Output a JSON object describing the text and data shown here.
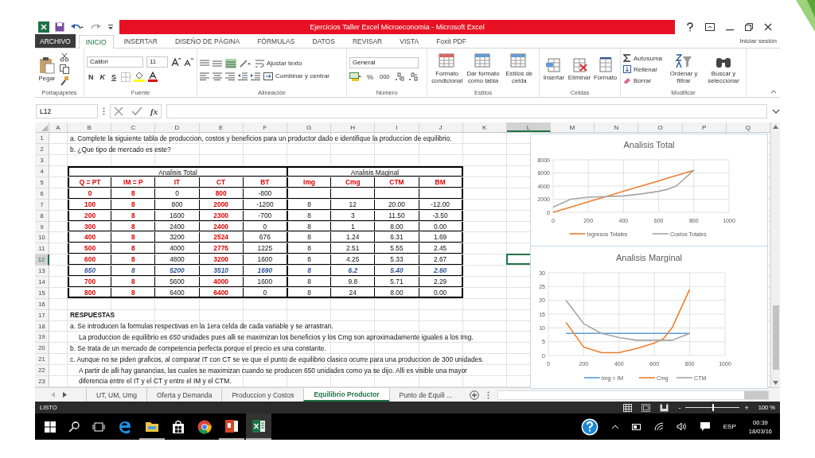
{
  "window": {
    "title": "Ejercicios Taller Excel Microeconomia -  Microsoft Excel"
  },
  "ribbon_tabs": [
    {
      "label": "ARCHIVO",
      "kind": "file",
      "selected": false
    },
    {
      "label": "INICIO",
      "kind": "tab",
      "selected": true
    },
    {
      "label": "INSERTAR",
      "kind": "tab",
      "selected": false
    },
    {
      "label": "DISEÑO DE PÁGINA",
      "kind": "tab",
      "selected": false
    },
    {
      "label": "FÓRMULAS",
      "kind": "tab",
      "selected": false
    },
    {
      "label": "DATOS",
      "kind": "tab",
      "selected": false
    },
    {
      "label": "REVISAR",
      "kind": "tab",
      "selected": false
    },
    {
      "label": "VISTA",
      "kind": "tab",
      "selected": false
    },
    {
      "label": "Foxit PDF",
      "kind": "tab",
      "selected": false
    }
  ],
  "sign_in": "Iniciar sesión",
  "ribbon": {
    "clipboard": {
      "label": "Portapapeles",
      "paste": "Pegar"
    },
    "font": {
      "label": "Fuente",
      "family": "Calibri",
      "size": "11",
      "bold": "N",
      "italic": "K",
      "underline": "S"
    },
    "alignment": {
      "label": "Alineación",
      "wrap": "Ajustar texto",
      "merge": "Combinar y centrar"
    },
    "number": {
      "label": "Número",
      "format": "General",
      "percent": "%",
      "thousands": "000"
    },
    "styles": {
      "label": "Estilos",
      "buttons": [
        "Formato condicional",
        "Dar formato como tabla",
        "Estilos de celda"
      ]
    },
    "cells": {
      "label": "Celdas",
      "buttons": [
        "Insertar",
        "Eliminar",
        "Formato"
      ]
    },
    "editing": {
      "label": "Modificar",
      "autosum": "Autosuma",
      "fill": "Rellenar",
      "clear": "Borrar",
      "buttons": [
        "Ordenar y filtrar",
        "Buscar y seleccionar"
      ]
    }
  },
  "formula_bar": {
    "name_box": "L12",
    "fx": "fx"
  },
  "columns": [
    {
      "label": "A",
      "selected": false
    },
    {
      "label": "B",
      "selected": false
    },
    {
      "label": "C",
      "selected": false
    },
    {
      "label": "D",
      "selected": false
    },
    {
      "label": "E",
      "selected": false
    },
    {
      "label": "F",
      "selected": false
    },
    {
      "label": "G",
      "selected": false
    },
    {
      "label": "H",
      "selected": false
    },
    {
      "label": "I",
      "selected": false
    },
    {
      "label": "J",
      "selected": false
    },
    {
      "label": "K",
      "selected": false
    },
    {
      "label": "L",
      "selected": true
    },
    {
      "label": "M",
      "selected": false
    },
    {
      "label": "N",
      "selected": false
    },
    {
      "label": "O",
      "selected": false
    },
    {
      "label": "P",
      "selected": false
    },
    {
      "label": "Q",
      "selected": false
    }
  ],
  "rows": [
    {
      "number": "1",
      "selected": false,
      "kind": "text",
      "text": "a. Complete la siguiente tabla de produccion, costos y beneficios para un productor dado e identifique la produccion de equilibrio."
    },
    {
      "number": "2",
      "selected": false,
      "kind": "text",
      "text": "b. ¿Que tipo de mercado es este?"
    },
    {
      "number": "3",
      "selected": false,
      "kind": "empty"
    },
    {
      "number": "4",
      "selected": false,
      "kind": "table_header",
      "headers": [
        "Analisis Total",
        "Analisis Maginal"
      ]
    },
    {
      "number": "5",
      "selected": false,
      "kind": "table_row",
      "cells": [
        {
          "text": "Q = PT",
          "kind": "given"
        },
        {
          "text": "IM = P",
          "kind": "given"
        },
        {
          "text": "IT",
          "kind": "given"
        },
        {
          "text": "CT",
          "kind": "given"
        },
        {
          "text": "BT",
          "kind": "given"
        },
        {
          "text": "Img",
          "kind": "given"
        },
        {
          "text": "Cmg",
          "kind": "given"
        },
        {
          "text": "CTM",
          "kind": "given"
        },
        {
          "text": "BM",
          "kind": "given"
        }
      ]
    },
    {
      "number": "6",
      "selected": false,
      "kind": "table_row",
      "cells": [
        {
          "text": "0",
          "kind": "given"
        },
        {
          "text": "8",
          "kind": "given"
        },
        {
          "text": "0",
          "kind": "computed"
        },
        {
          "text": "800",
          "kind": "given"
        },
        {
          "text": "-800",
          "kind": "computed"
        }
      ]
    },
    {
      "number": "7",
      "selected": false,
      "kind": "table_row",
      "cells": [
        {
          "text": "100",
          "kind": "given"
        },
        {
          "text": "8",
          "kind": "given"
        },
        {
          "text": "800",
          "kind": "computed"
        },
        {
          "text": "2000",
          "kind": "given"
        },
        {
          "text": "-1200",
          "kind": "computed"
        },
        {
          "text": "8",
          "kind": "computed"
        },
        {
          "text": "12",
          "kind": "computed"
        },
        {
          "text": "20.00",
          "kind": "computed"
        },
        {
          "text": "-12.00",
          "kind": "computed"
        }
      ]
    },
    {
      "number": "8",
      "selected": false,
      "kind": "table_row",
      "cells": [
        {
          "text": "200",
          "kind": "given"
        },
        {
          "text": "8",
          "kind": "given"
        },
        {
          "text": "1600",
          "kind": "computed"
        },
        {
          "text": "2300",
          "kind": "given"
        },
        {
          "text": "-700",
          "kind": "computed"
        },
        {
          "text": "8",
          "kind": "computed"
        },
        {
          "text": "3",
          "kind": "computed"
        },
        {
          "text": "11.50",
          "kind": "computed"
        },
        {
          "text": "-3.50",
          "kind": "computed"
        }
      ]
    },
    {
      "number": "9",
      "selected": false,
      "kind": "table_row",
      "cells": [
        {
          "text": "300",
          "kind": "given"
        },
        {
          "text": "8",
          "kind": "given"
        },
        {
          "text": "2400",
          "kind": "computed"
        },
        {
          "text": "2400",
          "kind": "given"
        },
        {
          "text": "0",
          "kind": "computed"
        },
        {
          "text": "8",
          "kind": "computed"
        },
        {
          "text": "1",
          "kind": "computed"
        },
        {
          "text": "8.00",
          "kind": "computed"
        },
        {
          "text": "0.00",
          "kind": "computed"
        }
      ]
    },
    {
      "number": "10",
      "selected": false,
      "kind": "table_row",
      "cells": [
        {
          "text": "400",
          "kind": "given"
        },
        {
          "text": "8",
          "kind": "given"
        },
        {
          "text": "3200",
          "kind": "computed"
        },
        {
          "text": "2524",
          "kind": "given"
        },
        {
          "text": "676",
          "kind": "computed"
        },
        {
          "text": "8",
          "kind": "computed"
        },
        {
          "text": "1.24",
          "kind": "computed"
        },
        {
          "text": "6.31",
          "kind": "computed"
        },
        {
          "text": "1.69",
          "kind": "computed"
        }
      ]
    },
    {
      "number": "11",
      "selected": false,
      "kind": "table_row",
      "cells": [
        {
          "text": "500",
          "kind": "given"
        },
        {
          "text": "8",
          "kind": "given"
        },
        {
          "text": "4000",
          "kind": "computed"
        },
        {
          "text": "2775",
          "kind": "given"
        },
        {
          "text": "1225",
          "kind": "computed"
        },
        {
          "text": "8",
          "kind": "computed"
        },
        {
          "text": "2.51",
          "kind": "computed"
        },
        {
          "text": "5.55",
          "kind": "computed"
        },
        {
          "text": "2.45",
          "kind": "computed"
        }
      ]
    },
    {
      "number": "12",
      "selected": true,
      "kind": "table_row",
      "cells": [
        {
          "text": "600",
          "kind": "given"
        },
        {
          "text": "8",
          "kind": "given"
        },
        {
          "text": "4800",
          "kind": "computed"
        },
        {
          "text": "3200",
          "kind": "given"
        },
        {
          "text": "1600",
          "kind": "computed"
        },
        {
          "text": "8",
          "kind": "computed"
        },
        {
          "text": "4.25",
          "kind": "computed"
        },
        {
          "text": "5.33",
          "kind": "computed"
        },
        {
          "text": "2.67",
          "kind": "computed"
        }
      ]
    },
    {
      "number": "13",
      "selected": false,
      "kind": "table_row",
      "cells": [
        {
          "text": "650",
          "kind": "optimum"
        },
        {
          "text": "8",
          "kind": "optimum"
        },
        {
          "text": "5200",
          "kind": "optimum"
        },
        {
          "text": "3510",
          "kind": "optimum"
        },
        {
          "text": "1690",
          "kind": "optimum"
        },
        {
          "text": "8",
          "kind": "optimum"
        },
        {
          "text": "6.2",
          "kind": "optimum"
        },
        {
          "text": "5.40",
          "kind": "optimum"
        },
        {
          "text": "2.60",
          "kind": "optimum"
        }
      ]
    },
    {
      "number": "14",
      "selected": false,
      "kind": "table_row",
      "cells": [
        {
          "text": "700",
          "kind": "given"
        },
        {
          "text": "8",
          "kind": "given"
        },
        {
          "text": "5600",
          "kind": "computed"
        },
        {
          "text": "4000",
          "kind": "given"
        },
        {
          "text": "1600",
          "kind": "computed"
        },
        {
          "text": "8",
          "kind": "computed"
        },
        {
          "text": "9.8",
          "kind": "computed"
        },
        {
          "text": "5.71",
          "kind": "computed"
        },
        {
          "text": "2.29",
          "kind": "computed"
        }
      ]
    },
    {
      "number": "15",
      "selected": false,
      "kind": "table_row",
      "cells": [
        {
          "text": "800",
          "kind": "given"
        },
        {
          "text": "8",
          "kind": "given"
        },
        {
          "text": "6400",
          "kind": "computed"
        },
        {
          "text": "6400",
          "kind": "given"
        },
        {
          "text": "0",
          "kind": "computed"
        },
        {
          "text": "8",
          "kind": "computed"
        },
        {
          "text": "24",
          "kind": "computed"
        },
        {
          "text": "8.00",
          "kind": "computed"
        },
        {
          "text": "0.00",
          "kind": "computed"
        }
      ]
    },
    {
      "number": "16",
      "selected": false,
      "kind": "empty"
    },
    {
      "number": "17",
      "selected": false,
      "kind": "heading",
      "text": "RESPUESTAS"
    },
    {
      "number": "18",
      "selected": false,
      "kind": "text",
      "text": "a. Se introducen la formulas respectivas en la 1era celda de cada variable y se arrastran."
    },
    {
      "number": "19",
      "selected": false,
      "kind": "indented",
      "text": "La produccion de equilibrio es *650* unidades pues alli se maximizan los beneficios y los Cmg son aproximadamente iguales a los Img."
    },
    {
      "number": "20",
      "selected": false,
      "kind": "text",
      "text": "b. Se trata de un mercado de competencia perfecta porque el precio es una constante."
    },
    {
      "number": "21",
      "selected": false,
      "kind": "text",
      "text": "c. Aunque no se piden graficos, al comparar IT con CT se ve que el punto de equilibrio clasico ocurre para una produccion de 300 unidades."
    },
    {
      "number": "22",
      "selected": false,
      "kind": "indented",
      "text": "A partir de alli hay ganancias, las cuales se maximizan cuando se producen 650 unidades como ya se dijo. Alli es visible una mayor"
    },
    {
      "number": "23",
      "selected": false,
      "kind": "indented",
      "text": "diferencia entre el IT y el CT y entre el IM y el CTM."
    }
  ],
  "charts": [
    {
      "chart_data": {
        "type": "line",
        "title": "Analisis Total",
        "x": [
          0,
          100,
          200,
          300,
          400,
          500,
          600,
          650,
          700,
          800
        ],
        "series": [
          {
            "name": "Ingresos Totales",
            "color": "#ed7d31",
            "values": [
              0,
              800,
              1600,
              2400,
              3200,
              4000,
              4800,
              5200,
              5600,
              6400
            ]
          },
          {
            "name": "Costos Totales",
            "color": "#a5a5a5",
            "values": [
              800,
              2000,
              2300,
              2400,
              2500,
              2800,
              3200,
              3500,
              4000,
              6400
            ]
          }
        ],
        "grid": true,
        "legend": "bottom",
        "xlim": [
          0,
          1000
        ],
        "ylim": [
          0,
          8000
        ],
        "xticks": [
          0,
          200,
          400,
          600,
          800,
          1000
        ],
        "yticks": [
          0,
          2000,
          4000,
          6000,
          8000
        ]
      }
    },
    {
      "chart_data": {
        "type": "line",
        "title": "Analisis Marginal",
        "x": [
          100,
          200,
          300,
          400,
          500,
          600,
          650,
          700,
          800
        ],
        "series": [
          {
            "name": "Img = IM",
            "color": "#5b9bd5",
            "values": [
              8,
              8,
              8,
              8,
              8,
              8,
              8,
              8,
              8
            ]
          },
          {
            "name": "Cmg",
            "color": "#ed7d31",
            "values": [
              12,
              3,
              1,
              1,
              2.5,
              4.5,
              6,
              10,
              24
            ]
          },
          {
            "name": "CTM",
            "color": "#a5a5a5",
            "values": [
              20,
              11.5,
              8,
              6.5,
              5.5,
              5.5,
              5.5,
              5.5,
              8
            ]
          }
        ],
        "grid": true,
        "legend": "bottom",
        "xlim": [
          0,
          1000
        ],
        "ylim": [
          0,
          30
        ],
        "xticks": [
          0,
          200,
          400,
          600,
          800,
          1000
        ],
        "yticks": [
          0,
          5,
          10,
          15,
          20,
          25,
          30
        ]
      }
    }
  ],
  "sheet_tabs": [
    {
      "label": "UT, UM, Umg",
      "selected": false
    },
    {
      "label": "Oferta y Demanda",
      "selected": false
    },
    {
      "label": "Produccion y Costos",
      "selected": false
    },
    {
      "label": "Equilibrio Productor",
      "selected": true
    },
    {
      "label": "Punto de Equili ...",
      "selected": false
    }
  ],
  "status_bar": {
    "state": "LISTO",
    "zoom_out": "-",
    "zoom_in": "+",
    "zoom": {
      "level": 0.5
    },
    "zoom_text": "100 %"
  },
  "taskbar": {
    "language": "ESP",
    "time": "00:39",
    "date": "18/03/16"
  }
}
